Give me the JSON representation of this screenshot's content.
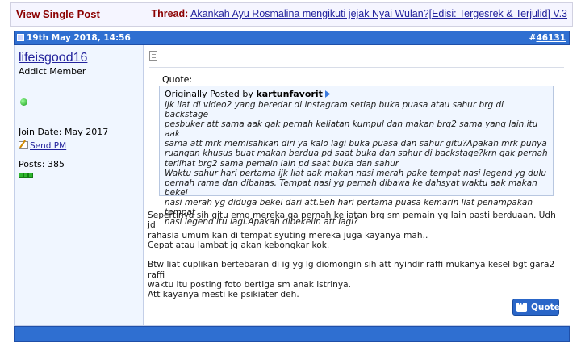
{
  "topbar": {
    "view_single": "View Single Post",
    "thread_label": "Thread:",
    "thread_title": "Akankah Ayu Rosmalina mengikuti jejak Nyai Wulan?[Edisi: Tergesrek & Terjulid] V.3"
  },
  "post": {
    "date": "19th May 2018, 14:56",
    "number_prefix": "#",
    "number": "46131",
    "user": {
      "name": "lifeisgood16",
      "title": "Addict Member",
      "join_date": "Join Date: May 2017",
      "send_pm": "Send PM",
      "posts": "Posts: 385",
      "online_status_color": "#1a9e1a",
      "reputation_color": "#2db52d"
    },
    "quote": {
      "label": "Quote:",
      "by_prefix": "Originally Posted by",
      "by_user": "kartunfavorit",
      "text": "ijk liat di video2 yang beredar di instagram setiap buka puasa atau sahur brg di backstage\npesbuker att sama aak gak pernah keliatan kumpul dan makan brg2 sama yang lain.itu aak\nsama att mrk memisahkan diri ya kalo lagi buka puasa dan sahur gitu?Apakah mrk punya\nruangan khusus buat makan berdua pd saat buka dan sahur di backstage?krn gak pernah\nterlihat brg2 sama pemain lain pd saat buka dan sahur\nWaktu sahur hari pertama ijk liat aak makan nasi merah pake tempat nasi legend yg dulu\npernah rame dan dibahas. Tempat nasi yg pernah dibawa ke dahsyat waktu aak makan bekel\nnasi merah yg diduga bekel dari att.Eeh hari pertama puasa kemarin liat penampakan tempat\nnasi legend itu lagi.Apakah dibekelin att lagi?"
    },
    "message": "Sepertinya sih gitu emg mereka ga pernah keliatan brg sm pemain yg lain pasti berduaan. Udh jd\nrahasia umum kan di tempat syuting mereka juga kayanya mah..\nCepat atau lambat jg akan kebongkar kok.\n\nBtw liat cuplikan bertebaran di ig yg lg diomongin sih att nyindir raffi mukanya kesel bgt gara2 raffi\nwaktu itu posting foto bertiga sm anak istrinya.\nAtt kayanya mesti ke psikiater deh.",
    "quote_button": "Quote"
  },
  "colors": {
    "header_blue": "#2f6fd1",
    "title_red": "#8b0000",
    "link_blue": "#22229c",
    "user_panel_bg": "#f0f6ff"
  }
}
